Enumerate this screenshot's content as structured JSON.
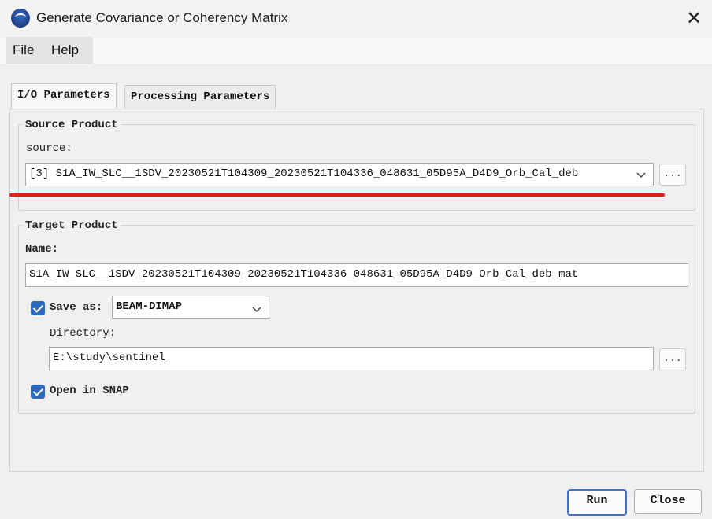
{
  "window": {
    "title": "Generate Covariance or Coherency Matrix",
    "close_glyph": "✕"
  },
  "menu": {
    "file": "File",
    "help": "Help"
  },
  "tabs": [
    {
      "label": "I/O Parameters",
      "active": true
    },
    {
      "label": "Processing Parameters",
      "active": false
    }
  ],
  "source_product": {
    "group_title": "Source Product",
    "source_label": "source:",
    "selected": "[3] S1A_IW_SLC__1SDV_20230521T104309_20230521T104336_048631_05D95A_D4D9_Orb_Cal_deb",
    "browse": "..."
  },
  "target_product": {
    "group_title": "Target Product",
    "name_label": "Name:",
    "name_value": "S1A_IW_SLC__1SDV_20230521T104309_20230521T104336_048631_05D95A_D4D9_Orb_Cal_deb_mat",
    "save_as_label": "Save as:",
    "save_as_checked": true,
    "format": "BEAM-DIMAP",
    "directory_label": "Directory:",
    "directory_value": "E:\\study\\sentinel",
    "browse": "...",
    "open_in_snap_label": "Open in SNAP",
    "open_in_snap_checked": true
  },
  "buttons": {
    "run": "Run",
    "close": "Close"
  },
  "colors": {
    "accent": "#2d69bd",
    "annotation_line": "#e0201c"
  }
}
